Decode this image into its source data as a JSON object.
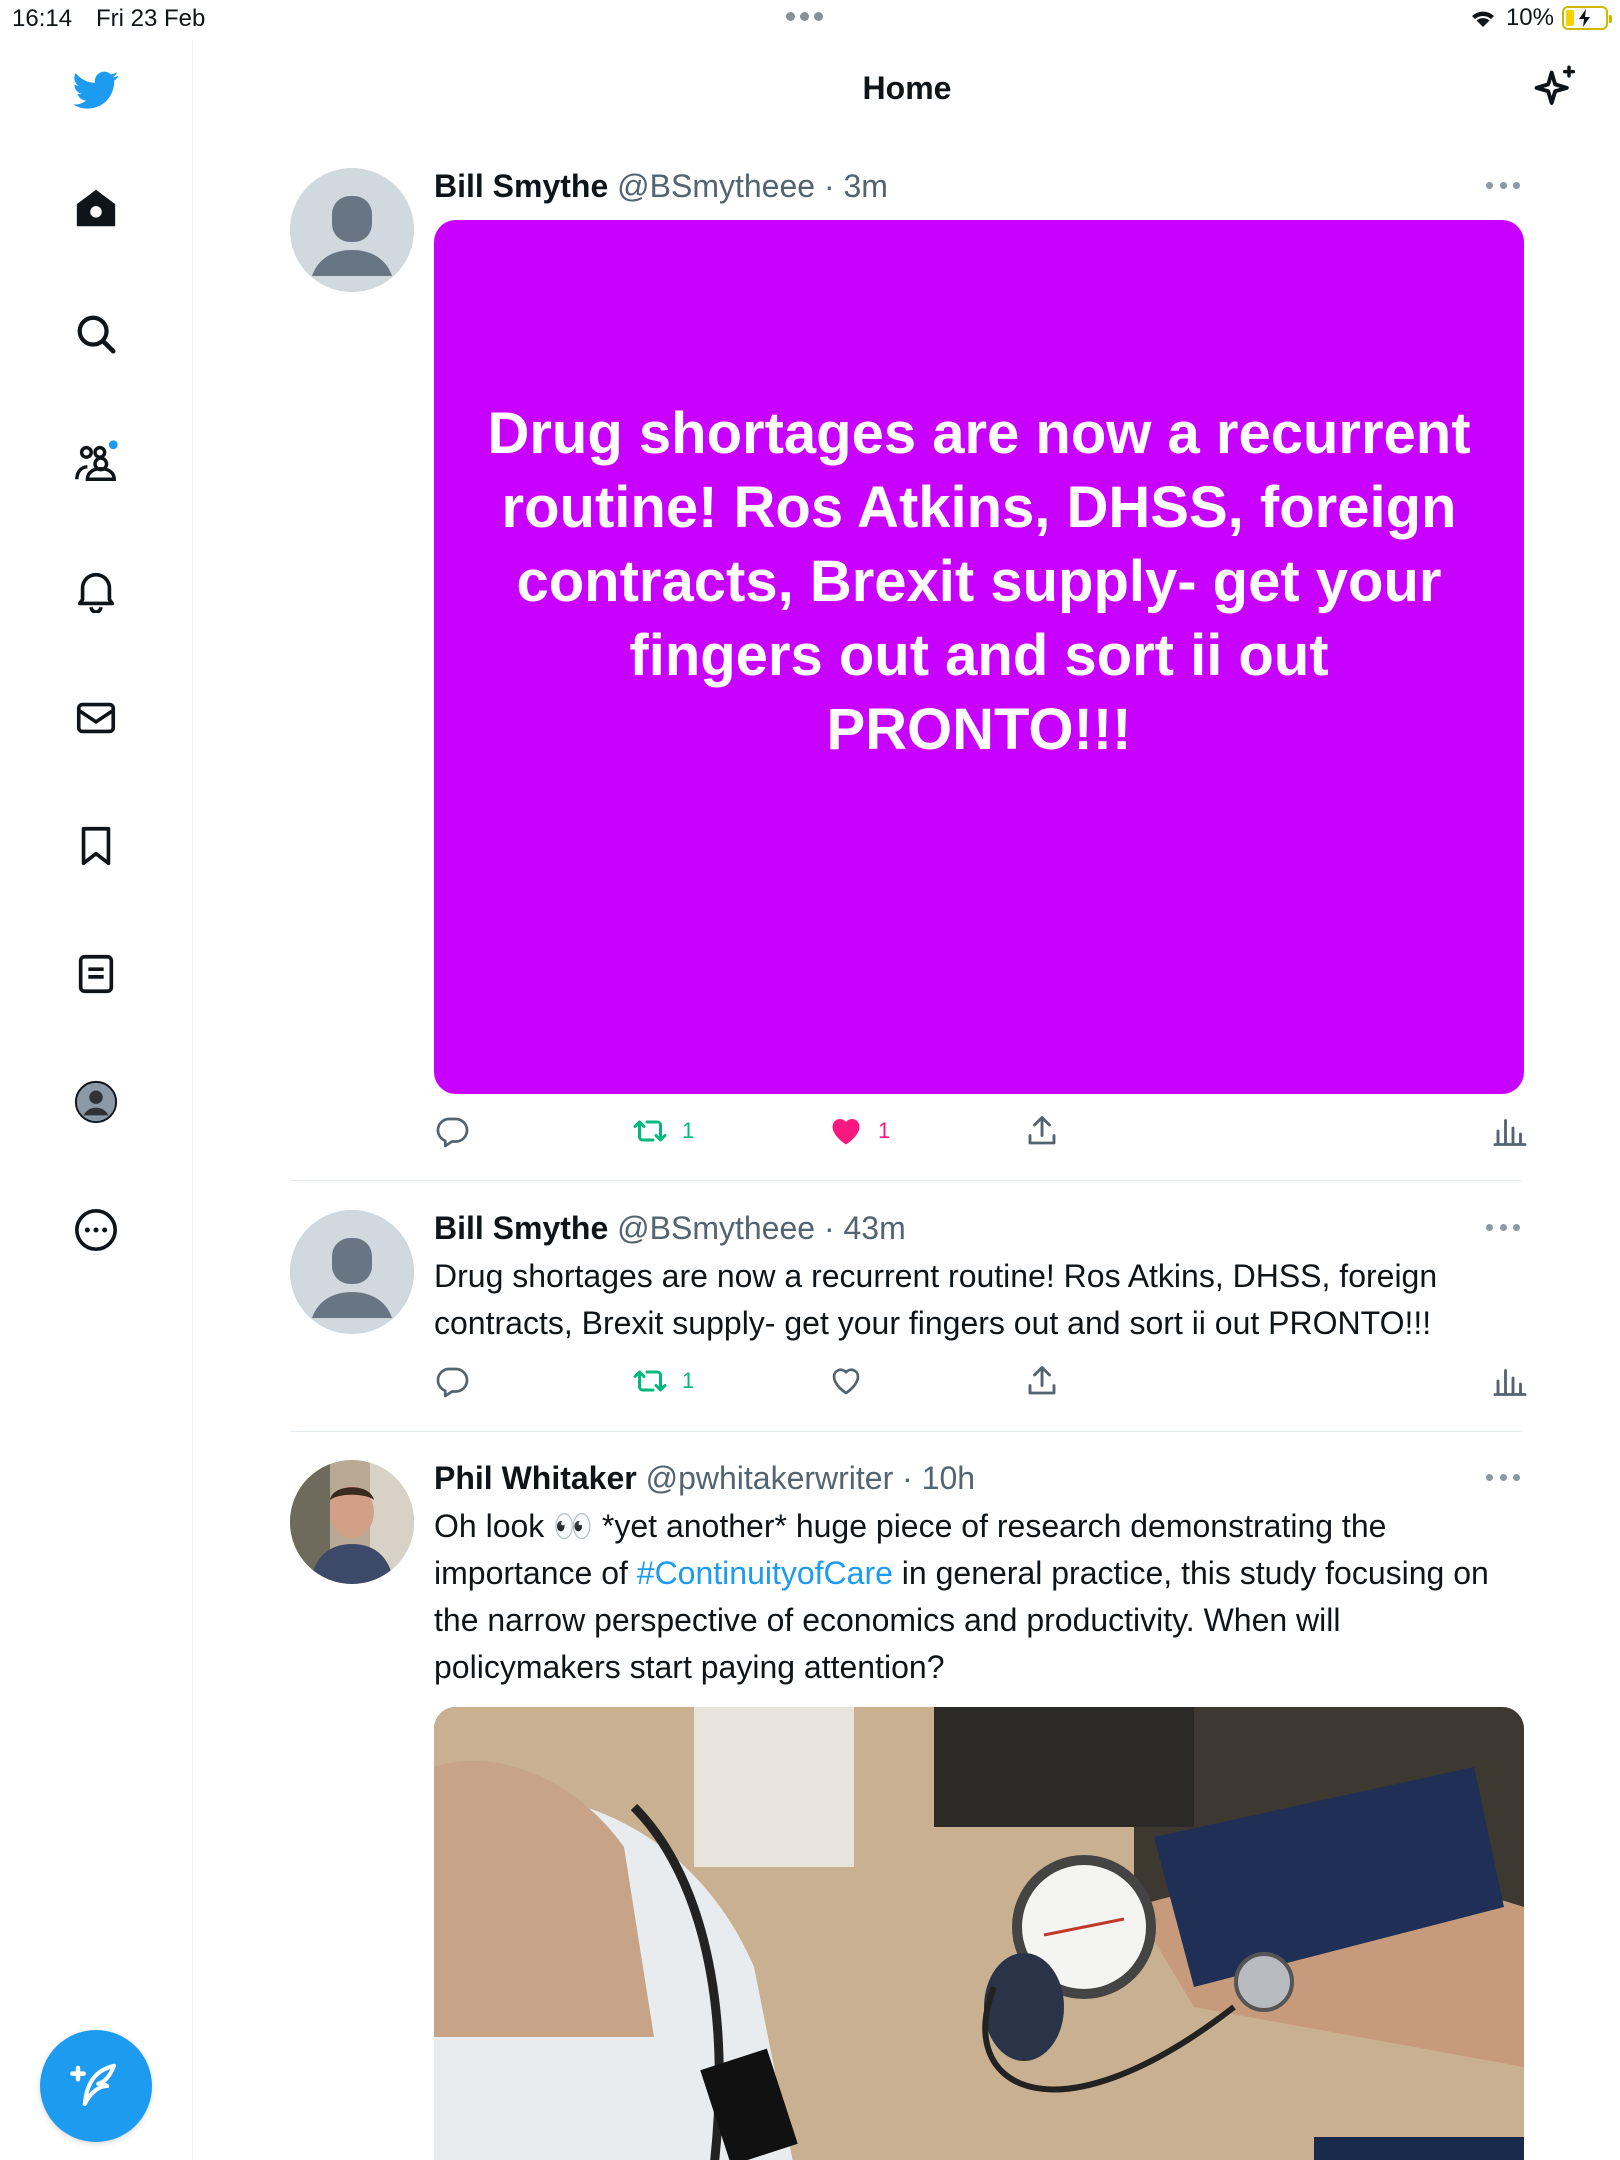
{
  "status_bar": {
    "time": "16:14",
    "date": "Fri 23 Feb",
    "battery": "10%"
  },
  "header": {
    "title": "Home"
  },
  "colors": {
    "accent": "#1d9bf0",
    "retweet_green": "#00ba7c",
    "like_pink": "#f91880",
    "purple_card": "#c800ff"
  },
  "sidebar": {
    "items": [
      "twitter-logo-icon",
      "home-icon",
      "search-icon",
      "communities-icon",
      "notifications-icon",
      "messages-icon",
      "bookmarks-icon",
      "lists-icon",
      "profile-icon",
      "more-icon"
    ],
    "compose_icon": "compose-tweet-icon"
  },
  "tweets": [
    {
      "name": "Bill Smythe",
      "handle": "@BSmytheee",
      "separator": "·",
      "time": "3m",
      "media_text": "Drug shortages are now a recurrent routine! Ros Atkins, DHSS, foreign contracts, Brexit supply- get your fingers out and sort ii out PRONTO!!!",
      "retweets": "1",
      "likes": "1",
      "liked": true
    },
    {
      "name": "Bill Smythe",
      "handle": "@BSmytheee",
      "separator": "·",
      "time": "43m",
      "text": "Drug shortages are now a recurrent routine! Ros Atkins, DHSS, foreign contracts, Brexit supply- get your fingers out and sort ii out PRONTO!!!",
      "retweets": "1",
      "liked": false
    },
    {
      "name": "Phil Whitaker",
      "handle": "@pwhitakerwriter",
      "separator": "·",
      "time": "10h",
      "text_before": "Oh look 👀 *yet another* huge piece of research demonstrating the importance of ",
      "hashtag": "#ContinuityofCare",
      "text_after": " in general practice, this study focusing on the narrow perspective of economics and productivity. When will policymakers start paying attention?"
    }
  ]
}
